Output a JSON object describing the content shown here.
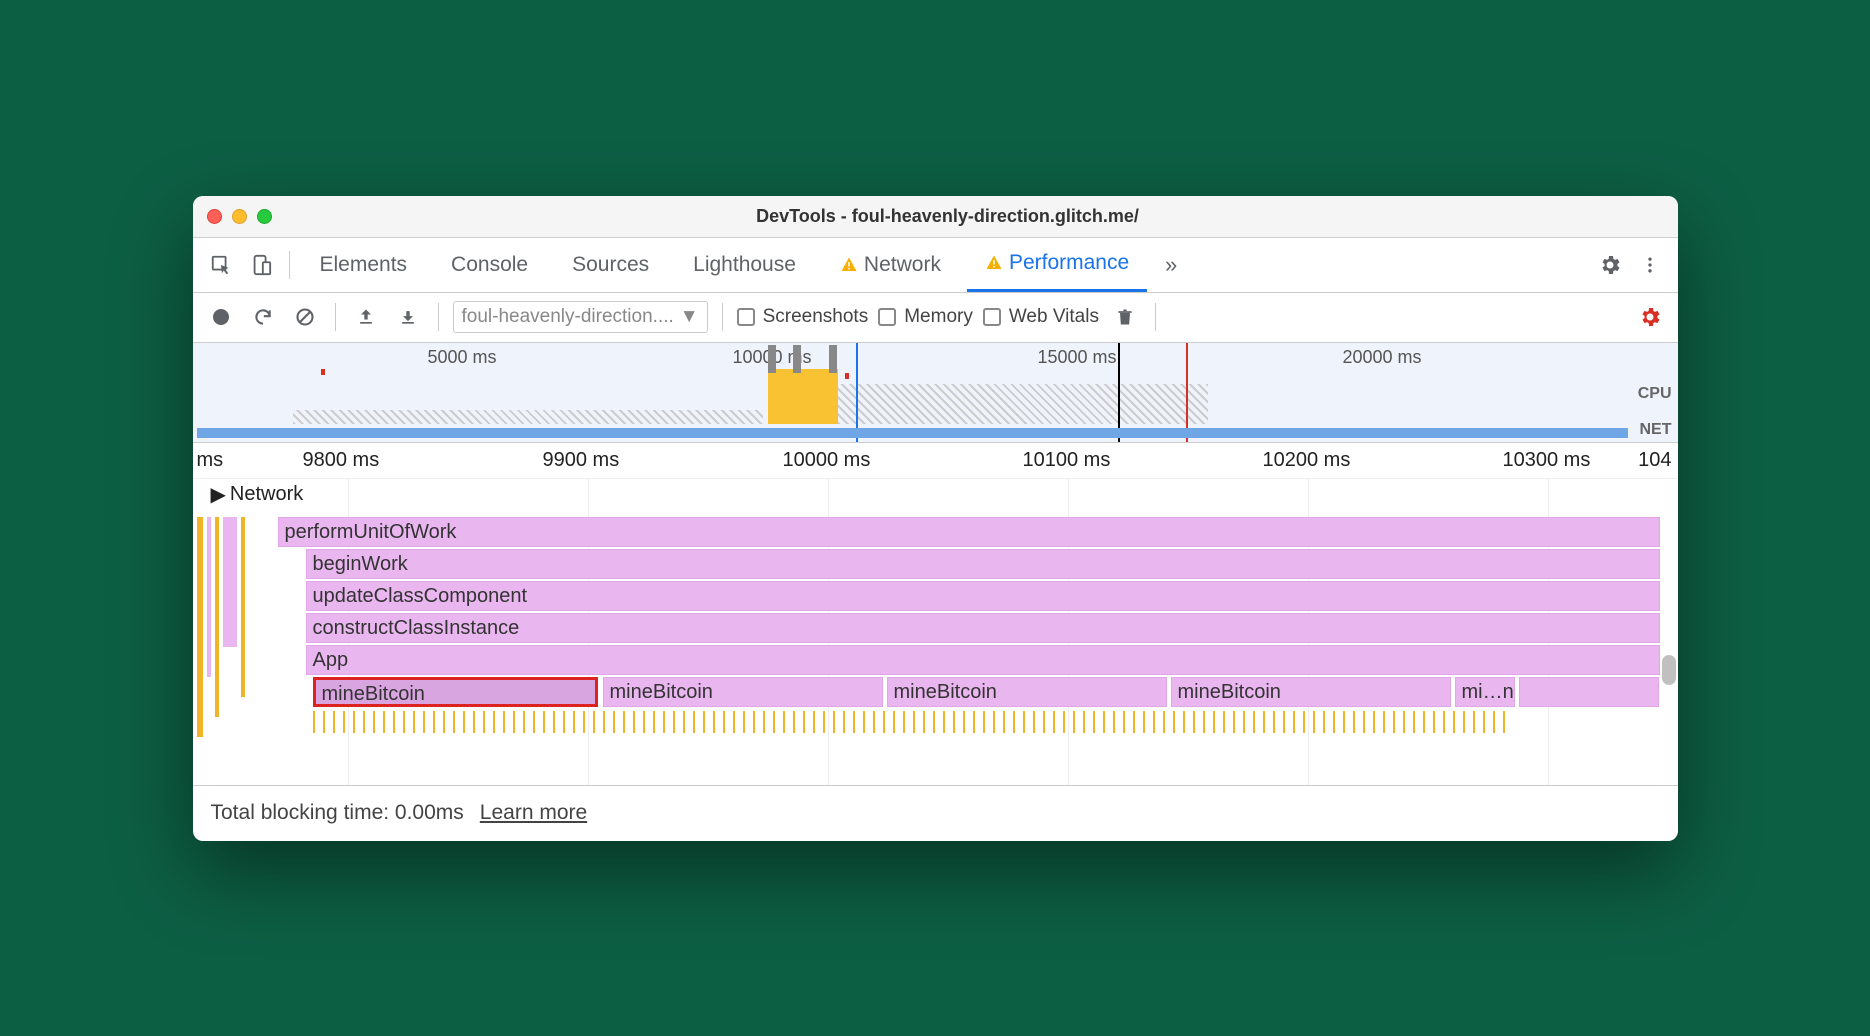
{
  "window": {
    "title": "DevTools - foul-heavenly-direction.glitch.me/"
  },
  "tabs": {
    "items": [
      "Elements",
      "Console",
      "Sources",
      "Lighthouse",
      "Network",
      "Performance"
    ],
    "active": "Performance",
    "warn": [
      "Network",
      "Performance"
    ]
  },
  "toolbar": {
    "select": "foul-heavenly-direction....",
    "screenshots": "Screenshots",
    "memory": "Memory",
    "webvitals": "Web Vitals"
  },
  "overview": {
    "labels": [
      "5000 ms",
      "10000 ms",
      "15000 ms",
      "20000 ms"
    ],
    "cpu": "CPU",
    "net": "NET"
  },
  "ruler": {
    "start": "ms",
    "ticks": [
      "9800 ms",
      "9900 ms",
      "10000 ms",
      "10100 ms",
      "10200 ms",
      "10300 ms"
    ],
    "end": "104"
  },
  "flame": {
    "network": "Network",
    "stack": [
      "performUnitOfWork",
      "beginWork",
      "updateClassComponent",
      "constructClassInstance",
      "App"
    ],
    "calls": [
      "mineBitcoin",
      "mineBitcoin",
      "mineBitcoin",
      "mineBitcoin",
      "mi…n"
    ]
  },
  "footer": {
    "tbt": "Total blocking time: 0.00ms",
    "learn": "Learn more"
  }
}
